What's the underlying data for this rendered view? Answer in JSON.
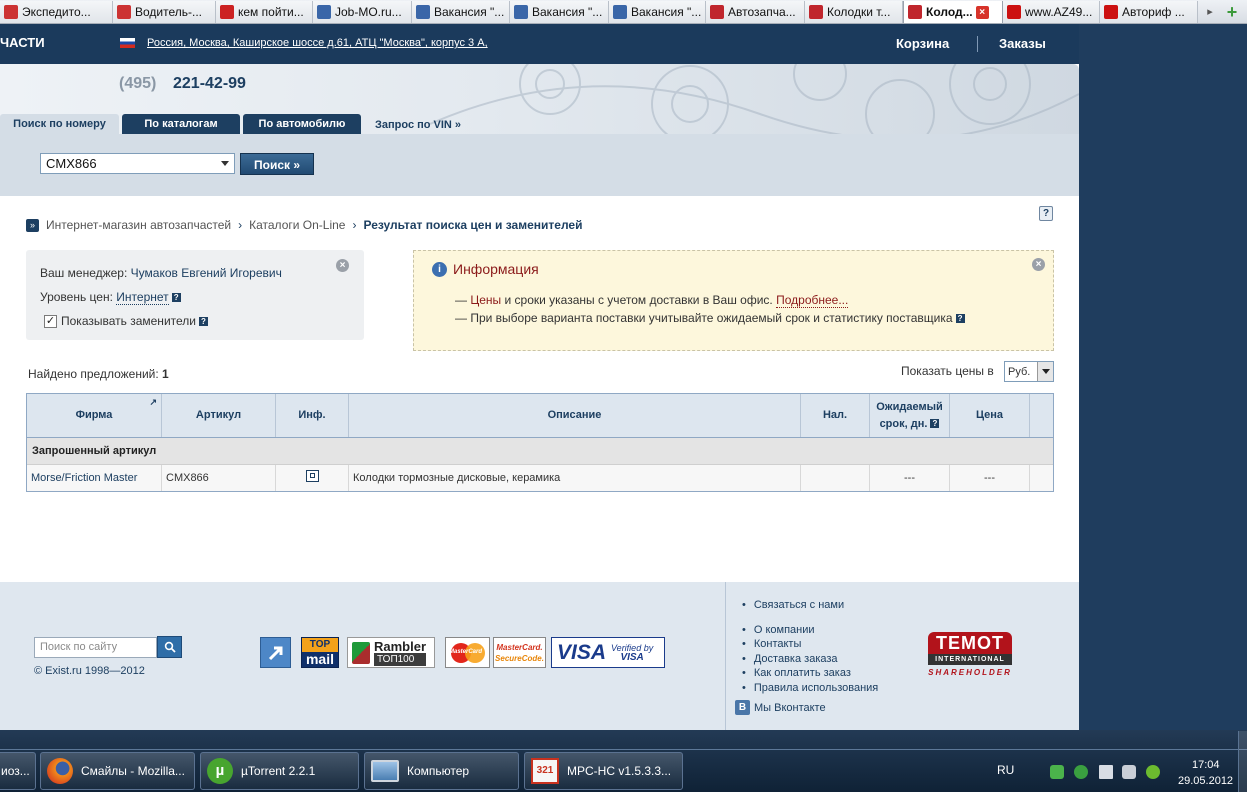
{
  "browser": {
    "tabs": [
      {
        "label": "Экспедито...",
        "color": "#cc3333"
      },
      {
        "label": "Водитель-...",
        "color": "#cc3333"
      },
      {
        "label": "кем пойти...",
        "color": "#cc2222"
      },
      {
        "label": "Job-MO.ru...",
        "color": "#3a66a8"
      },
      {
        "label": "Вакансия \"...",
        "color": "#3a66a8"
      },
      {
        "label": "Вакансия \"...",
        "color": "#3a66a8"
      },
      {
        "label": "Вакансия \"...",
        "color": "#3a66a8"
      },
      {
        "label": "Автозапча...",
        "color": "#c0262d"
      },
      {
        "label": "Колодки т...",
        "color": "#c0262d"
      },
      {
        "label": "Колод...",
        "color": "#c0262d"
      },
      {
        "label": "www.AZ49...",
        "color": "#cc1111"
      },
      {
        "label": "Авториф ...",
        "color": "#cc1111"
      }
    ],
    "active_tab_index": 9,
    "scroll_right": "▸",
    "new_tab": "+"
  },
  "site": {
    "brand_fragment": "ЧАСТИ",
    "address": "Россия, Москва, Каширское шоссе д.61, АТЦ \"Москва\", корпус 3 А,",
    "nav": {
      "cart": "Корзина",
      "orders": "Заказы"
    },
    "phone_code": "(495)",
    "phone_number": "221-42-99",
    "tabs": [
      {
        "label": "Поиск по номеру"
      },
      {
        "label": "По каталогам"
      },
      {
        "label": "По автомобилю"
      },
      {
        "label": "Запрос по VIN »"
      }
    ],
    "search": {
      "value": "CMX866",
      "button": "Поиск »"
    }
  },
  "breadcrumb": {
    "items": [
      "Интернет-магазин автозапчастей",
      "Каталоги On-Line"
    ],
    "separator": "›",
    "current": "Результат поиска цен и заменителей"
  },
  "manager_box": {
    "manager_label": "Ваш менеджер:",
    "manager_name": "Чумаков Евгений Игоревич",
    "price_level_label": "Уровень цен:",
    "price_level_value": "Интернет",
    "show_substitutes_label": "Показывать заменители",
    "show_substitutes_checked": true
  },
  "info_box": {
    "title": "Информация",
    "line1_prefix": "— ",
    "line1_link": "Цены",
    "line1_text": " и сроки указаны с учетом доставки в Ваш офис. ",
    "line1_more": "Подробнее...",
    "line2": "— При выборе варианта поставки учитывайте ожидаемый срок и статистику поставщика"
  },
  "results": {
    "found_label": "Найдено предложений:",
    "found_count": "1",
    "show_prices_label": "Показать цены в",
    "currency": "Руб.",
    "columns": {
      "firm": "Фирма",
      "article": "Артикул",
      "info": "Инф.",
      "description": "Описание",
      "availability": "Нал.",
      "expected_1": "Ожидаемый",
      "expected_2": "срок, дн.",
      "price": "Цена"
    },
    "section_label": "Запрошенный артикул",
    "rows": [
      {
        "firm": "Morse/Friction Master",
        "article": "CMX866",
        "description": "Колодки тормозные дисковые, керамика",
        "availability": "",
        "expected": "---",
        "price": "---"
      }
    ]
  },
  "footer": {
    "search_placeholder": "Поиск по сайту",
    "copyright": "© Exist.ru 1998—2012",
    "badges": {
      "top_mail_1": "TOP",
      "top_mail_2": "mail",
      "rambler_1": "Rambler",
      "rambler_2": "ТОП100",
      "mastercard": "MasterCard",
      "mastercard_sc_1": "MasterCard.",
      "mastercard_sc_2": "SecureCode.",
      "visa": "VISA",
      "visa_verified_1": "Verified by",
      "visa_verified_2": "VISA"
    },
    "links_top": "Связаться с нами",
    "links": [
      "О компании",
      "Контакты",
      "Доставка заказа",
      "Как оплатить заказ",
      "Правила использования"
    ],
    "vk_icon_letter": "B",
    "vk": "Мы Вконтакте",
    "temot": {
      "name": "TEMOT",
      "sub": "INTERNATIONAL",
      "role": "SHAREHOLDER"
    }
  },
  "taskbar": {
    "start_fragment": "иоз...",
    "items": [
      {
        "label": "Смайлы - Mozilla..."
      },
      {
        "label": "µTorrent 2.2.1"
      },
      {
        "label": "Компьютер"
      },
      {
        "label": "MPC-HC v1.5.3.3..."
      }
    ],
    "lang": "RU",
    "time": "17:04",
    "date": "29.05.2012"
  }
}
